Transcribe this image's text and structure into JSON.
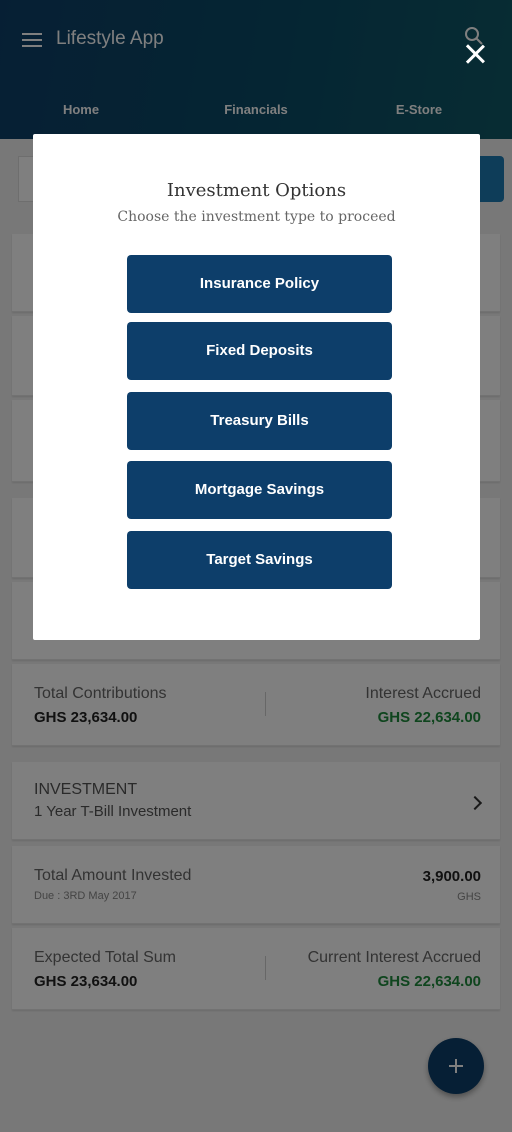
{
  "app": {
    "title": "Lifestyle App"
  },
  "tabs": [
    {
      "label": "Home"
    },
    {
      "label": "Financials"
    },
    {
      "label": "E-Store"
    }
  ],
  "contributions_card": {
    "left_label": "Total Contributions",
    "left_value": "GHS 23,634.00",
    "right_label": "Interest Accrued",
    "right_value": "GHS 22,634.00"
  },
  "investment_card": {
    "heading": "INVESTMENT",
    "name": "1 Year T-Bill Investment"
  },
  "invested_card": {
    "label": "Total Amount Invested",
    "due": "Due : 3RD May 2017",
    "value": "3,900.00",
    "currency": "GHS"
  },
  "expected_card": {
    "left_label": "Expected Total Sum",
    "left_value": "GHS 23,634.00",
    "right_label": "Current Interest Accrued",
    "right_value": "GHS 22,634.00"
  },
  "modal": {
    "title": "Investment Options",
    "subtitle": "Choose the investment type to proceed",
    "options": [
      {
        "label": "Insurance Policy"
      },
      {
        "label": "Fixed Deposits"
      },
      {
        "label": "Treasury Bills"
      },
      {
        "label": "Mortgage Savings"
      },
      {
        "label": "Target Savings"
      }
    ]
  },
  "colors": {
    "header": "#0d3f68",
    "button": "#0d3e6a",
    "accent_green": "#1f8a3c"
  },
  "icons": [
    "menu-icon",
    "search-icon",
    "close-icon",
    "chevron-right-icon",
    "add-icon"
  ]
}
